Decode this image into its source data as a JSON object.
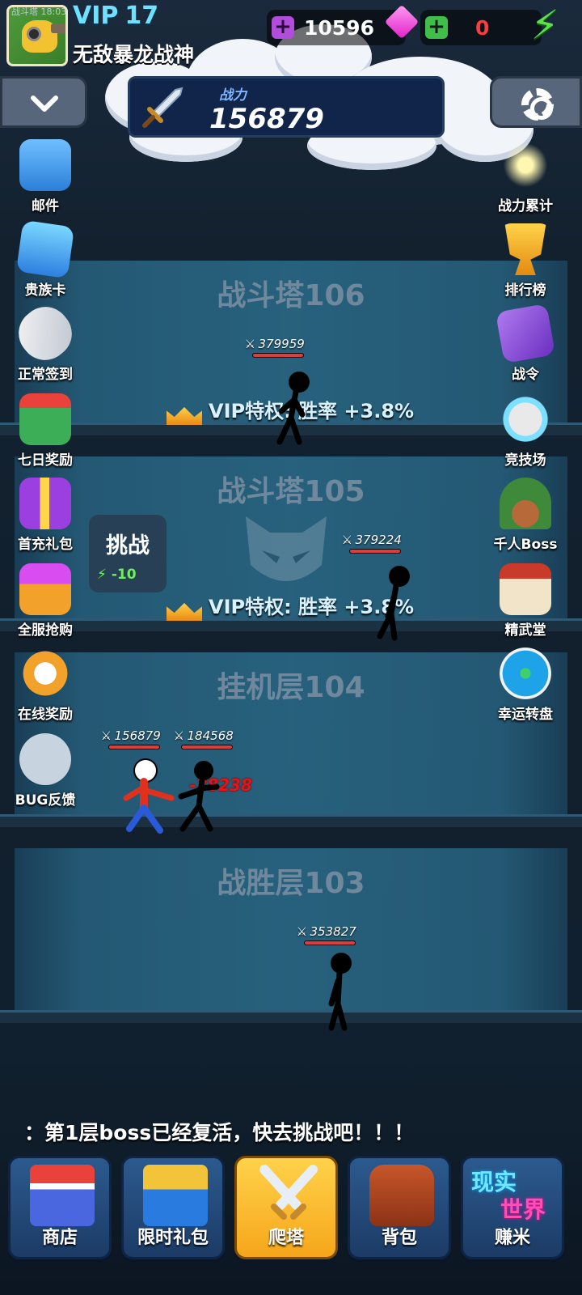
{
  "status_time": "战斗塔 18:03",
  "player": {
    "vip_label": "VIP",
    "vip_level": "17",
    "name": "无敌暴龙战神"
  },
  "resources": {
    "gems": "10596",
    "energy": "0"
  },
  "power": {
    "label": "战力",
    "value": "156879"
  },
  "left_menu": [
    {
      "label": "邮件",
      "icon": "mail-icon"
    },
    {
      "label": "贵族卡",
      "icon": "noble-card-icon"
    },
    {
      "label": "正常签到",
      "icon": "scroll-icon"
    },
    {
      "label": "七日奖励",
      "icon": "gift-box-icon"
    },
    {
      "label": "首充礼包",
      "icon": "purple-gift-icon"
    },
    {
      "label": "全服抢购",
      "icon": "treasure-icon"
    },
    {
      "label": "在线奖励",
      "icon": "stopwatch-icon"
    },
    {
      "label": "BUG反馈",
      "icon": "chat-bubble-icon"
    }
  ],
  "right_menu": [
    {
      "label": "战力累计",
      "icon": "sword-icon"
    },
    {
      "label": "排行榜",
      "icon": "trophy-icon"
    },
    {
      "label": "战令",
      "icon": "book-icon"
    },
    {
      "label": "竞技场",
      "icon": "arena-skull-icon"
    },
    {
      "label": "千人Boss",
      "icon": "door-tree-icon"
    },
    {
      "label": "精武堂",
      "icon": "dojo-icon"
    },
    {
      "label": "幸运转盘",
      "icon": "wheel-icon"
    }
  ],
  "floors": [
    {
      "name": "战斗塔106",
      "vip": "VIP特权: 胜率 +3.8%",
      "enemy_power": "379959"
    },
    {
      "name": "战斗塔105",
      "vip": "VIP特权: 胜率 +3.8%",
      "enemy_power": "379224"
    },
    {
      "name": "挂机层104",
      "player_power": "156879",
      "enemy_power": "184568",
      "damage": "-28238"
    },
    {
      "name": "战胜层103",
      "enemy_power": "353827"
    }
  ],
  "challenge": {
    "label": "挑战",
    "cost": "-10"
  },
  "notice": "：第1层boss已经复活，快去挑战吧！！！",
  "nav": [
    {
      "label": "商店",
      "icon": "shop-icon"
    },
    {
      "label": "限时礼包",
      "icon": "chest-icon"
    },
    {
      "label": "爬塔",
      "icon": "crossed-swords-icon"
    },
    {
      "label": "背包",
      "icon": "backpack-icon"
    },
    {
      "label": "赚米",
      "icon": "real-world-icon",
      "badge_top": "现实",
      "badge_bottom": "世界"
    }
  ],
  "colors": {
    "accent_cyan": "#6fe0ff",
    "nav_active": "#f6a61a",
    "energy_green": "#5ee04a",
    "gem_pink": "#e21fc9"
  }
}
